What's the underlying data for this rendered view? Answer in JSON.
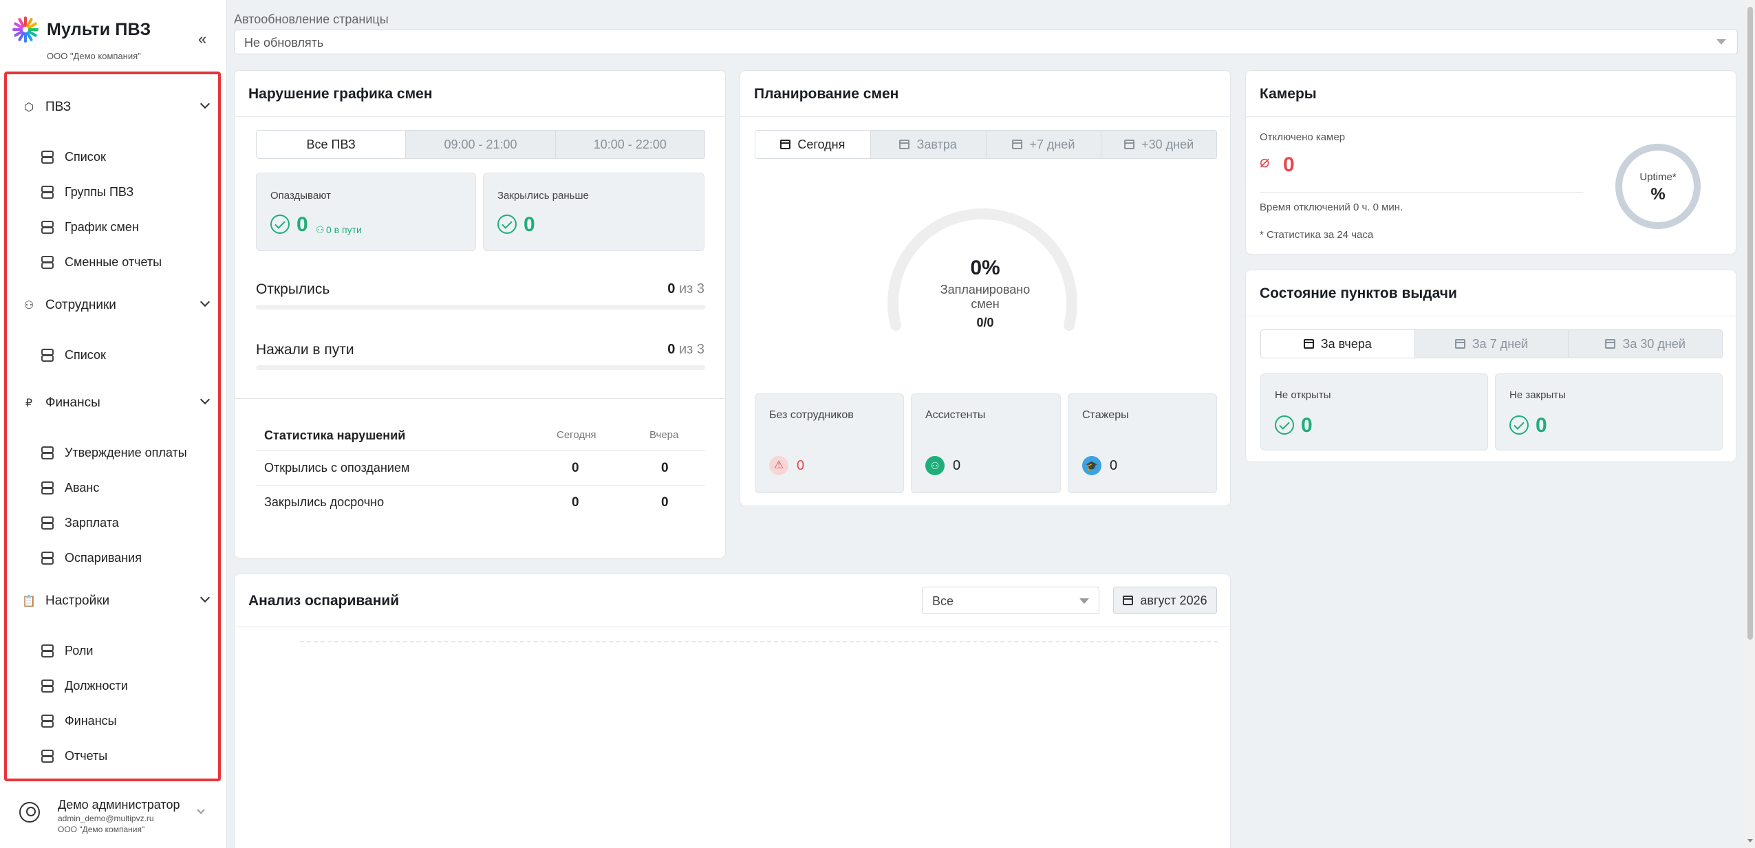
{
  "sidebar": {
    "brand_title": "Мульти ПВЗ",
    "brand_sub": "ООО \"Демо компания\"",
    "collapse": "«",
    "groups": [
      {
        "label": "ПВЗ",
        "items": [
          "Список",
          "Группы ПВЗ",
          "График смен",
          "Сменные отчеты"
        ]
      },
      {
        "label": "Сотрудники",
        "items": [
          "Список"
        ]
      },
      {
        "label": "Финансы",
        "items": [
          "Утверждение оплаты",
          "Аванс",
          "Зарплата",
          "Оспаривания"
        ]
      },
      {
        "label": "Настройки",
        "items": [
          "Роли",
          "Должности",
          "Финансы",
          "Отчеты"
        ]
      }
    ],
    "user": {
      "name": "Демо администратор",
      "email": "admin_demo@multipvz.ru",
      "company": "ООО \"Демо компания\""
    }
  },
  "autoupdate": {
    "label": "Автообновление страницы",
    "value": "Не обновлять"
  },
  "violations": {
    "title": "Нарушение графика смен",
    "tabs": [
      "Все ПВЗ",
      "09:00 - 21:00",
      "10:00 - 22:00"
    ],
    "late": {
      "label": "Опаздывают",
      "value": "0",
      "sub": "0 в пути"
    },
    "early": {
      "label": "Закрылись раньше",
      "value": "0"
    },
    "opened": {
      "label": "Открылись",
      "value": "0",
      "of": "из 3"
    },
    "on_way": {
      "label": "Нажали в пути",
      "value": "0",
      "of": "из 3"
    },
    "stats": {
      "title": "Статистика нарушений",
      "col_today": "Сегодня",
      "col_yesterday": "Вчера",
      "rows": [
        {
          "label": "Открылись с опозданием",
          "today": "0",
          "yesterday": "0"
        },
        {
          "label": "Закрылись досрочно",
          "today": "0",
          "yesterday": "0"
        }
      ]
    }
  },
  "planning": {
    "title": "Планирование смен",
    "tabs": [
      "Сегодня",
      "Завтра",
      "+7 дней",
      "+30 дней"
    ],
    "gauge": {
      "percent": "0%",
      "label_line1": "Запланировано",
      "label_line2": "смен",
      "ratio": "0/0",
      "fill_fraction": 0
    },
    "boxes": [
      {
        "label": "Без сотрудников",
        "value": "0",
        "color": "#e5484d"
      },
      {
        "label": "Ассистенты",
        "value": "0",
        "color": "#1fae7a"
      },
      {
        "label": "Стажеры",
        "value": "0",
        "color": "#3aa3e0"
      }
    ]
  },
  "cameras": {
    "title": "Камеры",
    "off_label": "Отключено камер",
    "off_value": "0",
    "downtime": "Время отключений 0 ч. 0 мин.",
    "note": "* Статистика за 24 часа",
    "uptime_label": "Uptime*",
    "uptime_value": "%"
  },
  "points": {
    "title": "Состояние пунктов выдачи",
    "tabs": [
      "За вчера",
      "За 7 дней",
      "За 30 дней"
    ],
    "not_opened": {
      "label": "Не открыты",
      "value": "0"
    },
    "not_closed": {
      "label": "Не закрыты",
      "value": "0"
    }
  },
  "disputes": {
    "title": "Анализ оспариваний",
    "filter": "Все",
    "month": "август 2026"
  },
  "colors": {
    "accent_green": "#1fae7a",
    "danger": "#e5484d",
    "highlight_border": "#e8353a"
  }
}
